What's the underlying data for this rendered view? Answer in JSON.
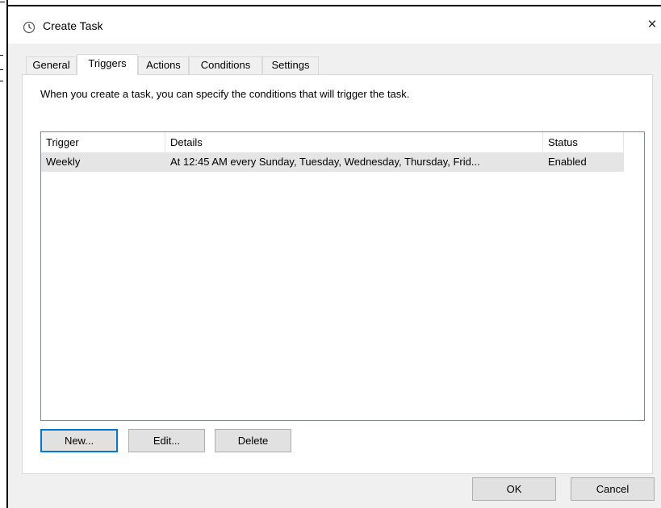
{
  "window": {
    "title": "Create Task",
    "close_glyph": "×",
    "icon": "clock-icon"
  },
  "tabs": [
    {
      "label": "General",
      "active": false
    },
    {
      "label": "Triggers",
      "active": true
    },
    {
      "label": "Actions",
      "active": false
    },
    {
      "label": "Conditions",
      "active": false
    },
    {
      "label": "Settings",
      "active": false
    }
  ],
  "triggers_panel": {
    "description": "When you create a task, you can specify the conditions that will trigger the task.",
    "columns": [
      "Trigger",
      "Details",
      "Status"
    ],
    "rows": [
      {
        "trigger": "Weekly",
        "details": "At 12:45 AM every Sunday, Tuesday, Wednesday, Thursday, Frid...",
        "status": "Enabled",
        "selected": true
      }
    ],
    "buttons": {
      "new": "New...",
      "edit": "Edit...",
      "delete": "Delete"
    }
  },
  "footer": {
    "ok": "OK",
    "cancel": "Cancel"
  },
  "colors": {
    "accent": "#0078d7",
    "selection": "#e5e5e5",
    "dialog_bg": "#f0f0f0"
  }
}
